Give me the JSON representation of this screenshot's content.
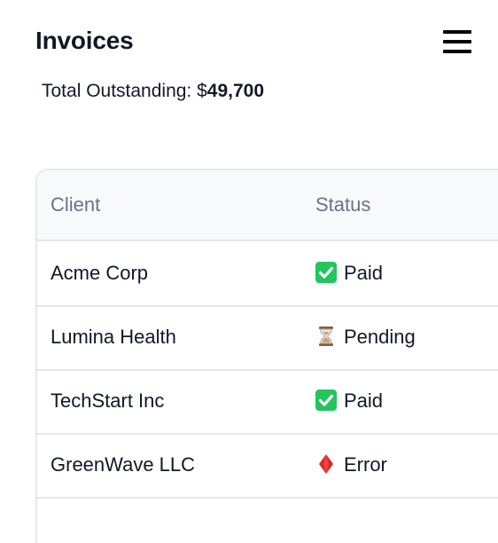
{
  "header": {
    "title": "Invoices"
  },
  "summary": {
    "label": "Total Outstanding: $",
    "amount": "49,700"
  },
  "table": {
    "columns": [
      "Client",
      "Status"
    ],
    "rows": [
      {
        "client": "Acme Corp",
        "status": "Paid",
        "icon": "check-icon"
      },
      {
        "client": "Lumina Health",
        "status": "Pending",
        "icon": "hourglass-icon"
      },
      {
        "client": "TechStart Inc",
        "status": "Paid",
        "icon": "check-icon"
      },
      {
        "client": "GreenWave LLC",
        "status": "Error",
        "icon": "diamond-icon"
      }
    ]
  },
  "colors": {
    "paid": "#22c55e",
    "error": "#dc2626",
    "border": "#e5e7eb",
    "header_text": "#64748b"
  }
}
